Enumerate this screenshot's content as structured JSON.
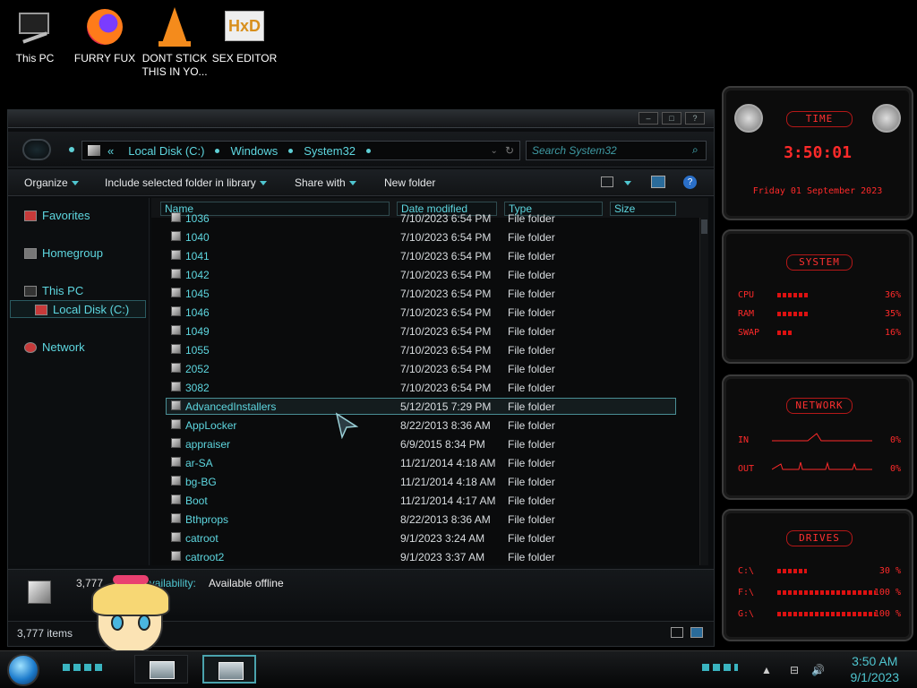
{
  "desktop": {
    "icons": [
      {
        "label": "This PC"
      },
      {
        "label": "FURRY FUX"
      },
      {
        "label": "DONT STICK THIS IN YO..."
      },
      {
        "label": "SEX EDITOR"
      }
    ]
  },
  "explorer": {
    "address": {
      "prefix": "«",
      "crumbs": [
        "Local Disk (C:)",
        "Windows",
        "System32"
      ]
    },
    "search_placeholder": "Search System32",
    "commands": {
      "organize": "Organize",
      "include": "Include selected folder in library",
      "share": "Share with",
      "new_folder": "New folder"
    },
    "nav": {
      "favorites": "Favorites",
      "homegroup": "Homegroup",
      "this_pc": "This PC",
      "local_disk": "Local Disk (C:)",
      "network": "Network"
    },
    "columns": {
      "name": "Name",
      "date": "Date modified",
      "type": "Type",
      "size": "Size"
    },
    "rows": [
      {
        "name": "1036",
        "date": "7/10/2023 6:54 PM",
        "type": "File folder"
      },
      {
        "name": "1040",
        "date": "7/10/2023 6:54 PM",
        "type": "File folder"
      },
      {
        "name": "1041",
        "date": "7/10/2023 6:54 PM",
        "type": "File folder"
      },
      {
        "name": "1042",
        "date": "7/10/2023 6:54 PM",
        "type": "File folder"
      },
      {
        "name": "1045",
        "date": "7/10/2023 6:54 PM",
        "type": "File folder"
      },
      {
        "name": "1046",
        "date": "7/10/2023 6:54 PM",
        "type": "File folder"
      },
      {
        "name": "1049",
        "date": "7/10/2023 6:54 PM",
        "type": "File folder"
      },
      {
        "name": "1055",
        "date": "7/10/2023 6:54 PM",
        "type": "File folder"
      },
      {
        "name": "2052",
        "date": "7/10/2023 6:54 PM",
        "type": "File folder"
      },
      {
        "name": "3082",
        "date": "7/10/2023 6:54 PM",
        "type": "File folder"
      },
      {
        "name": "AdvancedInstallers",
        "date": "5/12/2015 7:29 PM",
        "type": "File folder"
      },
      {
        "name": "AppLocker",
        "date": "8/22/2013 8:36 AM",
        "type": "File folder"
      },
      {
        "name": "appraiser",
        "date": "6/9/2015 8:34 PM",
        "type": "File folder"
      },
      {
        "name": "ar-SA",
        "date": "11/21/2014 4:18 AM",
        "type": "File folder"
      },
      {
        "name": "bg-BG",
        "date": "11/21/2014 4:18 AM",
        "type": "File folder"
      },
      {
        "name": "Boot",
        "date": "11/21/2014 4:17 AM",
        "type": "File folder"
      },
      {
        "name": "Bthprops",
        "date": "8/22/2013 8:36 AM",
        "type": "File folder"
      },
      {
        "name": "catroot",
        "date": "9/1/2023 3:24 AM",
        "type": "File folder"
      },
      {
        "name": "catroot2",
        "date": "9/1/2023 3:37 AM",
        "type": "File folder"
      }
    ],
    "selected_index": 10,
    "details": {
      "count": "3,777",
      "availability_label": "Availability:",
      "availability_value": "Available offline"
    },
    "status": {
      "items": "3,777 items"
    }
  },
  "gadgets": {
    "time": {
      "title": "TIME",
      "clock": "3:50:01",
      "date": "Friday 01 September 2023"
    },
    "system": {
      "title": "SYSTEM",
      "rows": [
        {
          "label": "CPU",
          "value": "36%",
          "level": 0.36
        },
        {
          "label": "RAM",
          "value": "35%",
          "level": 0.35
        },
        {
          "label": "SWAP",
          "value": "16%",
          "level": 0.16
        }
      ]
    },
    "network": {
      "title": "NETWORK",
      "in_label": "IN",
      "in_value": "0%",
      "out_label": "OUT",
      "out_value": "0%"
    },
    "drives": {
      "title": "DRIVES",
      "rows": [
        {
          "label": "C:\\",
          "value": "30 %",
          "level": 0.3
        },
        {
          "label": "F:\\",
          "value": "100 %",
          "level": 1.0
        },
        {
          "label": "G:\\",
          "value": "100 %",
          "level": 1.0
        }
      ]
    }
  },
  "taskbar": {
    "time": "3:50 AM",
    "date": "9/1/2023"
  }
}
